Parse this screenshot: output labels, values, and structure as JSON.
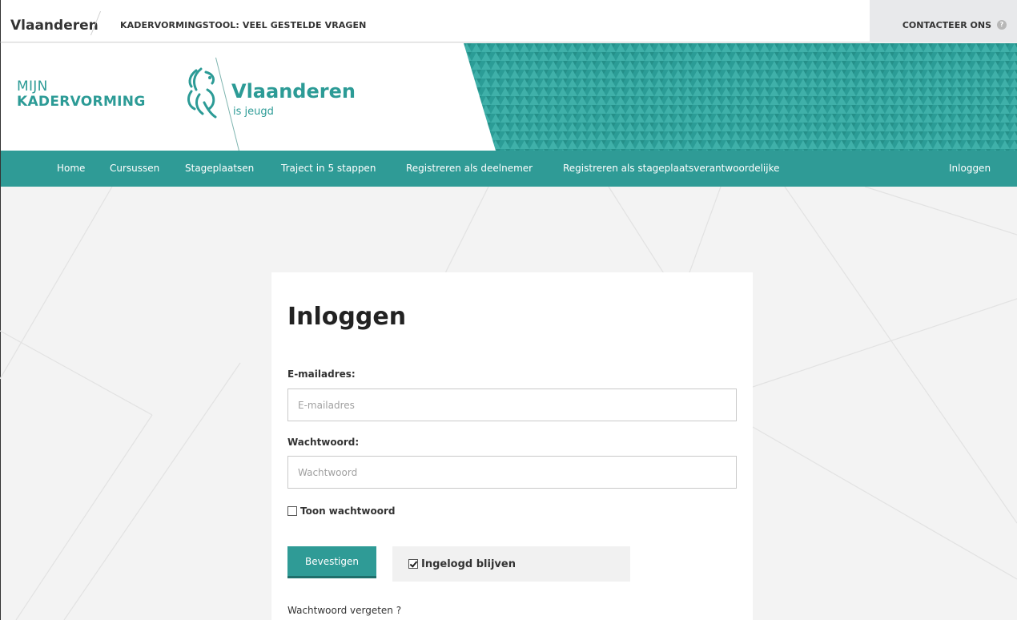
{
  "topbar": {
    "brand": "Vlaanderen",
    "breadcrumb": "KADERVORMINGSTOOL: VEEL GESTELDE VRAGEN",
    "contact": "CONTACTEER ONS",
    "help_glyph": "?"
  },
  "header": {
    "logo_line1": "MIJN",
    "logo_line2": "KADERVORMING",
    "vlaanderen": "Vlaanderen",
    "subtitle": "is jeugd",
    "icons": [
      "lion-icon"
    ],
    "accent_color": "#2f9b96"
  },
  "nav": {
    "items": [
      {
        "label": "Home"
      },
      {
        "label": "Cursussen"
      },
      {
        "label": "Stageplaatsen"
      },
      {
        "label": "Traject in 5 stappen"
      },
      {
        "label": "Registreren als deelnemer"
      },
      {
        "label": "Registreren als stageplaatsverantwoordelijke"
      },
      {
        "label": "Inloggen"
      }
    ]
  },
  "login": {
    "title": "Inloggen",
    "email_label": "E-mailadres:",
    "email_placeholder": "E-mailadres",
    "email_value": "",
    "password_label": "Wachtwoord:",
    "password_placeholder": "Wachtwoord",
    "password_value": "",
    "show_password_label": "Toon wachtwoord",
    "show_password_checked": false,
    "submit_label": "Bevestigen",
    "remember_label": "Ingelogd blijven",
    "remember_checked": true,
    "forgot_label": "Wachtwoord vergeten ?"
  }
}
